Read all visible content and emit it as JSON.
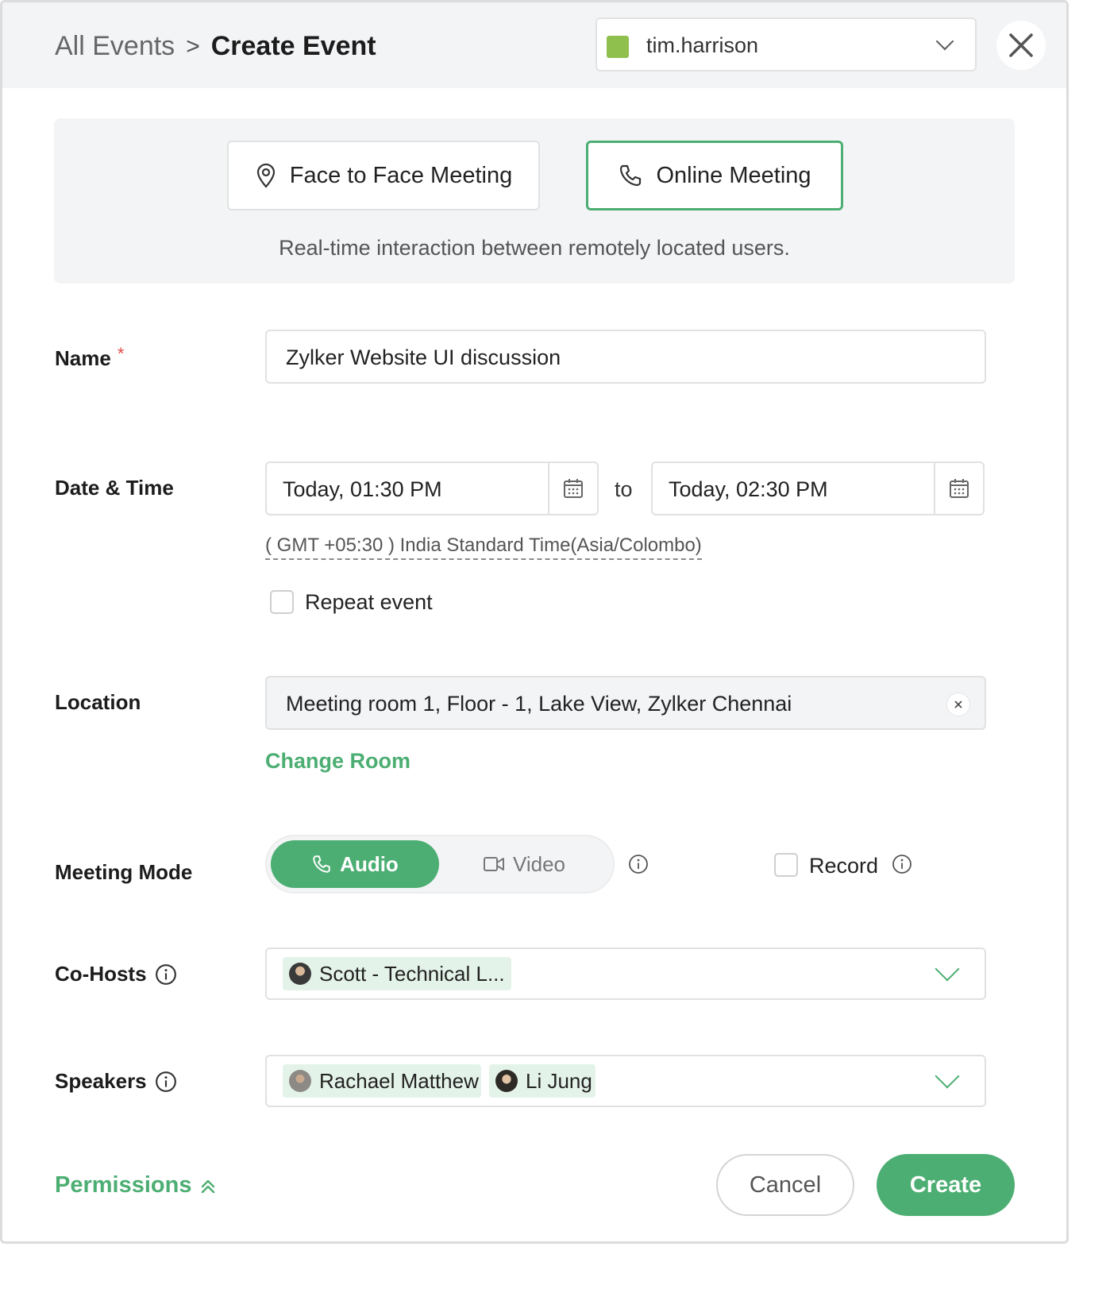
{
  "breadcrumb": {
    "parent": "All Events",
    "separator": ">",
    "current": "Create Event"
  },
  "user_selector": {
    "name": "tim.harrison",
    "swatch_color": "#8fc04e"
  },
  "meeting_type": {
    "options": [
      {
        "label": "Face to Face Meeting",
        "icon": "location-pin-icon",
        "selected": false
      },
      {
        "label": "Online Meeting",
        "icon": "phone-icon",
        "selected": true
      }
    ],
    "description": "Real-time interaction between remotely located users."
  },
  "form": {
    "name": {
      "label": "Name",
      "required_mark": "*",
      "value": "Zylker Website UI discussion"
    },
    "datetime": {
      "label": "Date & Time",
      "start": "Today, 01:30 PM",
      "to_label": "to",
      "end": "Today, 02:30 PM",
      "timezone": "( GMT +05:30 ) India Standard Time(Asia/Colombo)",
      "repeat_label": "Repeat event",
      "repeat_checked": false
    },
    "location": {
      "label": "Location",
      "value": "Meeting room 1, Floor - 1, Lake View, Zylker Chennai",
      "change_label": "Change Room"
    },
    "meeting_mode": {
      "label": "Meeting Mode",
      "options": [
        {
          "label": "Audio",
          "selected": true
        },
        {
          "label": "Video",
          "selected": false
        }
      ],
      "record_label": "Record",
      "record_checked": false
    },
    "cohosts": {
      "label": "Co-Hosts",
      "chips": [
        "Scott  - Technical L..."
      ]
    },
    "speakers": {
      "label": "Speakers",
      "chips": [
        "Rachael Matthew",
        "Li Jung"
      ]
    }
  },
  "footer": {
    "permissions_label": "Permissions",
    "cancel_label": "Cancel",
    "create_label": "Create"
  },
  "colors": {
    "accent": "#4cae72",
    "panel": "#f3f4f6",
    "chip": "#e4f3ea",
    "required": "#e24c4c"
  }
}
